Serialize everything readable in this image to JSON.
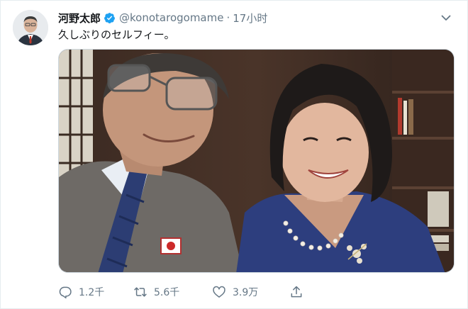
{
  "author": {
    "display_name": "河野太郎",
    "handle": "@konotarogomame",
    "separator": "·",
    "time": "17小时",
    "verified": true
  },
  "tweet": {
    "text": "久しぶりのセルフィー。"
  },
  "actions": {
    "replies": "1.2千",
    "retweets": "5.6千",
    "likes": "3.9万"
  },
  "icons": {
    "verified": "verified-badge-icon",
    "caret": "chevron-down-icon",
    "reply": "reply-icon",
    "retweet": "retweet-icon",
    "like": "heart-icon",
    "share": "share-icon"
  },
  "colors": {
    "text_primary": "#14171a",
    "text_secondary": "#657786",
    "verified_blue": "#1da1f2",
    "border": "#e6ecf0"
  }
}
